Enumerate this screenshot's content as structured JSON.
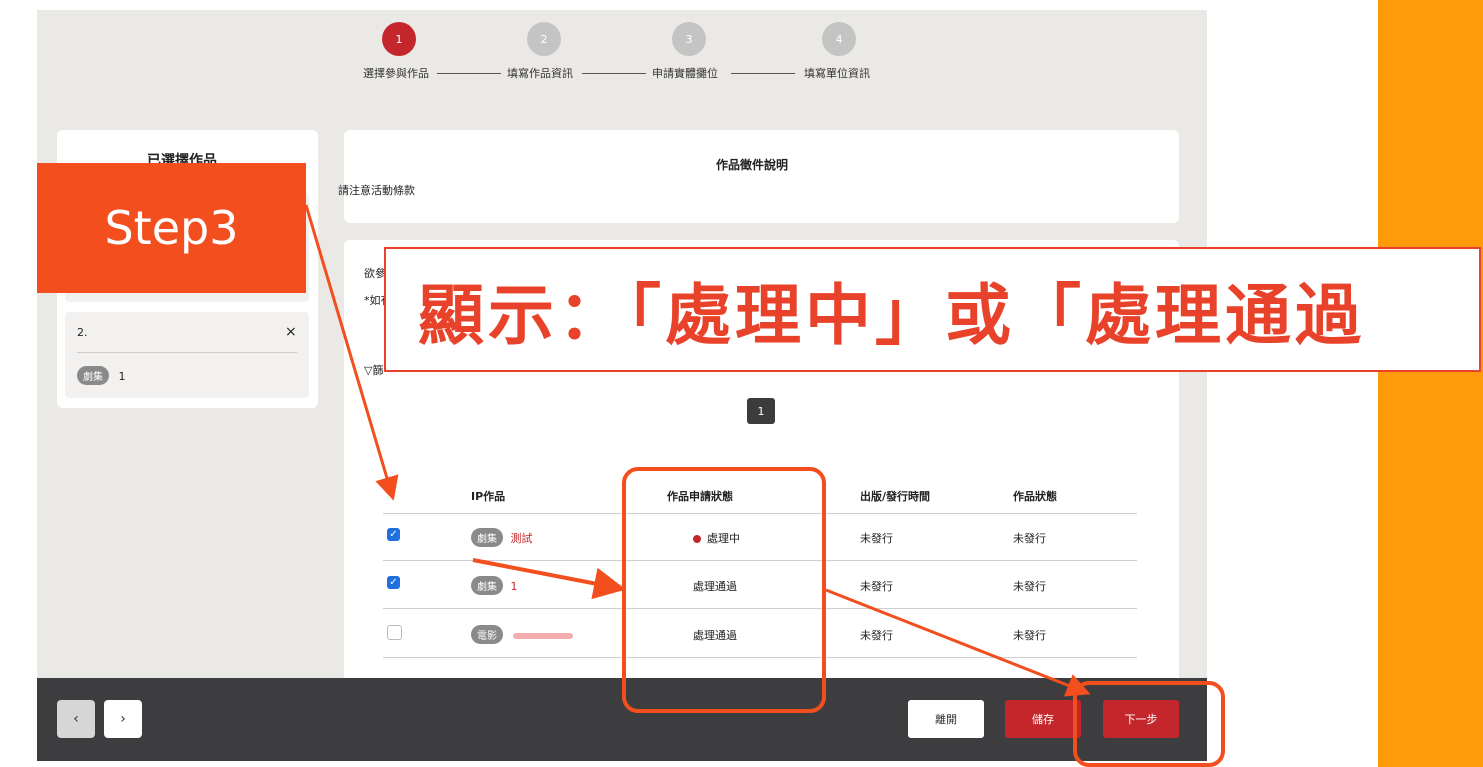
{
  "stepper": {
    "steps": [
      {
        "num": "1",
        "label": "選擇參與作品"
      },
      {
        "num": "2",
        "label": "填寫作品資訊"
      },
      {
        "num": "3",
        "label": "申請實體攤位"
      },
      {
        "num": "4",
        "label": "填寫單位資訊"
      }
    ]
  },
  "sidebar": {
    "title": "已選擇作品",
    "item": {
      "index": "2.",
      "tag": "劇集",
      "value": "1",
      "close": "×"
    }
  },
  "notice": {
    "title": "作品徵件說明",
    "text": "請注意活動條款"
  },
  "main": {
    "partial1": "欲參",
    "partial2": "*如有",
    "filter_icon": "▽",
    "filter_partial": "篩"
  },
  "pagination": {
    "current": "1"
  },
  "table": {
    "headers": [
      "IP作品",
      "作品申請狀態",
      "出版/發行時間",
      "作品狀態"
    ],
    "rows": [
      {
        "tag": "劇集",
        "name": "測試",
        "status": "處理中",
        "release": "未發行",
        "state": "未發行"
      },
      {
        "tag": "劇集",
        "name": "1",
        "status": "處理通過",
        "release": "未發行",
        "state": "未發行"
      },
      {
        "tag": "電影",
        "name": "",
        "status": "處理通過",
        "release": "未發行",
        "state": "未發行"
      }
    ]
  },
  "footer": {
    "prev": "‹",
    "next": "›",
    "leave": "離開",
    "save": "儲存",
    "next_step": "下一步"
  },
  "overlay": {
    "step_label": "Step3",
    "banner": "顯示：「處理中」或「處理通過"
  },
  "colors": {
    "accent": "#ff9a0a",
    "primary_red": "#c4272b",
    "callout": "#f24e1e"
  }
}
